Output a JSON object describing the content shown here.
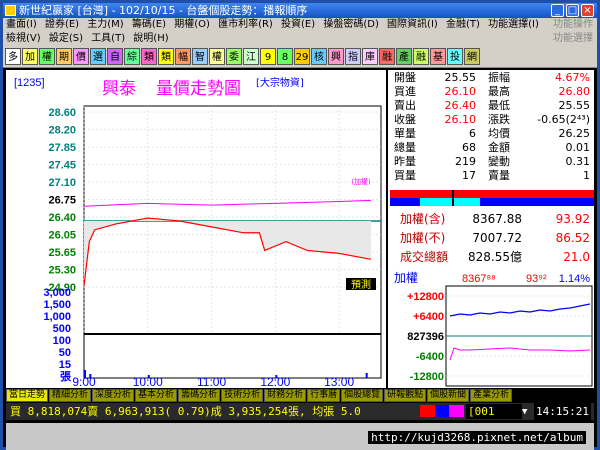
{
  "window": {
    "title": "新世紀贏家 [台灣] - 102/10/15 - 台盤個股走勢：播報順序",
    "controls": [
      "_",
      "□",
      "×"
    ]
  },
  "menu": {
    "row1": [
      "畫面(I)",
      "證券(E)",
      "主力(M)",
      "籌碼(E)",
      "期權(O)",
      "匯市利率(R)",
      "投資(E)",
      "操盤密碼(D)",
      "國際資訊(I)",
      "金融(T)",
      "功能選擇(I)"
    ],
    "row2": [
      "檢視(V)",
      "設定(S)",
      "工具(T)",
      "說明(H)"
    ],
    "right1": "功能操作",
    "right2": "功能選擇"
  },
  "toolbar": {
    "buttons": [
      {
        "label": "多",
        "bg": "#ffffff"
      },
      {
        "label": "加",
        "bg": "#ffff66"
      },
      {
        "label": "權",
        "bg": "#66ff66"
      },
      {
        "label": "期",
        "bg": "#ffcc66"
      },
      {
        "label": "價",
        "bg": "#ff99ff"
      },
      {
        "label": "選",
        "bg": "#66ccff"
      },
      {
        "label": "自",
        "bg": "#cc66ff"
      },
      {
        "label": "綜",
        "bg": "#66ff99"
      },
      {
        "label": "類",
        "bg": "#ff66cc"
      },
      {
        "label": "類",
        "bg": "#ffff00"
      },
      {
        "label": "幅",
        "bg": "#ff9966"
      },
      {
        "label": "智",
        "bg": "#99ccff"
      },
      {
        "label": "權",
        "bg": "#ffff99"
      },
      {
        "label": "委",
        "bg": "#99ff66"
      },
      {
        "label": "江",
        "bg": "#ccffcc"
      },
      {
        "label": "9",
        "bg": "#ffff00"
      },
      {
        "label": "8",
        "bg": "#66ff66"
      },
      {
        "label": "29",
        "bg": "#ffcc00"
      },
      {
        "label": "核",
        "bg": "#66ccff"
      },
      {
        "label": "興",
        "bg": "#ff99cc"
      },
      {
        "label": "指",
        "bg": "#ccccff"
      },
      {
        "label": "庫",
        "bg": "#ffccff"
      },
      {
        "label": "融",
        "bg": "#ff6666"
      },
      {
        "label": "產",
        "bg": "#66cc66"
      },
      {
        "label": "融",
        "bg": "#ccff66"
      },
      {
        "label": "基",
        "bg": "#ff9999"
      },
      {
        "label": "投",
        "bg": "#66ffff"
      },
      {
        "label": "網",
        "bg": "#cccc66"
      }
    ]
  },
  "stock": {
    "code": "[1235]",
    "name": "興泰",
    "chart_title": "量價走勢圖",
    "source": "[大宗物資]"
  },
  "chart_data": {
    "type": "line",
    "price_ticks": [
      "28.60",
      "28.20",
      "27.85",
      "27.45",
      "27.10",
      "26.75",
      "26.40",
      "26.05",
      "25.65",
      "25.30",
      "24.90"
    ],
    "volume_ticks": [
      "3,000",
      "1,500",
      "1,000",
      "500",
      "100",
      "50",
      "15",
      "張"
    ],
    "time_ticks": [
      "9:00",
      "10:00",
      "11:00",
      "12:00",
      "13:00"
    ],
    "reference_price": 26.75,
    "annotation": "預測",
    "avg_label": "(加權)",
    "price_series": [
      {
        "t": "9:00",
        "v": 25.65
      },
      {
        "t": "9:05",
        "v": 26.4
      },
      {
        "t": "9:10",
        "v": 26.6
      },
      {
        "t": "9:30",
        "v": 26.7
      },
      {
        "t": "10:00",
        "v": 26.8
      },
      {
        "t": "10:30",
        "v": 26.75
      },
      {
        "t": "11:00",
        "v": 26.65
      },
      {
        "t": "11:30",
        "v": 26.55
      },
      {
        "t": "11:45",
        "v": 26.55
      },
      {
        "t": "11:50",
        "v": 26.25
      },
      {
        "t": "12:10",
        "v": 26.4
      },
      {
        "t": "12:30",
        "v": 26.25
      },
      {
        "t": "13:00",
        "v": 26.2
      },
      {
        "t": "13:30",
        "v": 26.1
      }
    ],
    "avg_series": [
      {
        "t": "9:00",
        "v": 27.0
      },
      {
        "t": "10:00",
        "v": 27.05
      },
      {
        "t": "11:00",
        "v": 27.02
      },
      {
        "t": "12:00",
        "v": 27.05
      },
      {
        "t": "13:00",
        "v": 27.08
      },
      {
        "t": "13:30",
        "v": 27.1
      }
    ]
  },
  "quote": {
    "rows": [
      {
        "l1": "開盤",
        "v1": "25.55",
        "c1": "#000000",
        "l2": "振幅",
        "v2": "4.67%",
        "c2": "#ff0000"
      },
      {
        "l1": "買進",
        "v1": "26.10",
        "c1": "#ff0000",
        "l2": "最高",
        "v2": "26.80",
        "c2": "#ff0000"
      },
      {
        "l1": "賣出",
        "v1": "26.40",
        "c1": "#ff0000",
        "l2": "最低",
        "v2": "25.55",
        "c2": "#000000"
      },
      {
        "l1": "收盤",
        "v1": "26.10",
        "c1": "#ff0000",
        "l2": "漲跌",
        "v2": "-0.65(2⁴³)",
        "c2": "#000000"
      },
      {
        "l1": "單量",
        "v1": "6",
        "c1": "#000000",
        "l2": "均價",
        "v2": "26.25",
        "c2": "#000000"
      },
      {
        "l1": "總量",
        "v1": "68",
        "c1": "#000000",
        "l2": "金額",
        "v2": "0.01",
        "c2": "#000000"
      },
      {
        "l1": "昨量",
        "v1": "219",
        "c1": "#000000",
        "l2": "變動",
        "v2": "0.31",
        "c2": "#000000"
      },
      {
        "l1": "買量",
        "v1": "17",
        "c1": "#000000",
        "l2": "賣量",
        "v2": "1",
        "c2": "#000000"
      }
    ]
  },
  "index": {
    "rows": [
      {
        "label": "加權(含)",
        "value": "8367.88",
        "change": "93.92"
      },
      {
        "label": "加權(不)",
        "value": "7007.72",
        "change": "86.52"
      },
      {
        "label": "成交總額",
        "value": "828.55億",
        "change": "21.0"
      }
    ]
  },
  "mini_chart": {
    "title": "加權",
    "value": "8367⁸⁸",
    "change": "93⁹²",
    "pct": "1.14%",
    "ticks": [
      "+12800",
      "+6400",
      "827396",
      "-6400",
      "-12800"
    ]
  },
  "bottom_tabs": [
    "當日走勢",
    "精細分析",
    "深度分析",
    "基本分析",
    "籌碼分析",
    "技術分析",
    "財務分析",
    "行事曆",
    "個股總覽",
    "研報觀點",
    "個股新聞",
    "產業分析"
  ],
  "status": {
    "left": "買 8,818,074賣 6,963,913( 0.79)成 3,935,254張, 均張 5.0",
    "code": "[001",
    "time": "14:15:21"
  },
  "watermark": "http://kujd3268.pixnet.net/album",
  "colors": {
    "red": "#ff0000",
    "blue": "#0000ff",
    "teal": "#008080",
    "magenta": "#ff00ff",
    "title_blue": "#1552c4"
  }
}
